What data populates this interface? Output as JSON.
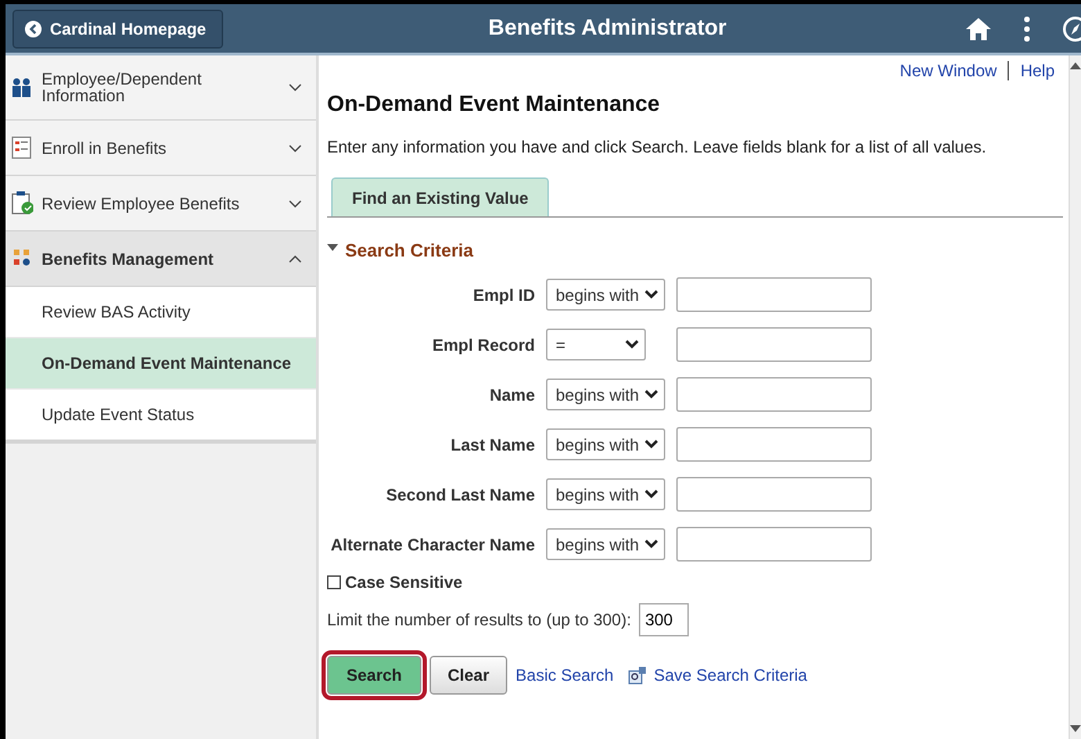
{
  "header": {
    "back_button": "Cardinal Homepage",
    "title": "Benefits Administrator"
  },
  "sidebar": {
    "items": [
      {
        "label": "Employee/Dependent Information",
        "expanded": false
      },
      {
        "label": "Enroll in Benefits",
        "expanded": false
      },
      {
        "label": "Review Employee Benefits",
        "expanded": false
      },
      {
        "label": "Benefits Management",
        "expanded": true,
        "children": [
          {
            "label": "Review BAS Activity",
            "selected": false
          },
          {
            "label": "On-Demand Event Maintenance",
            "selected": true
          },
          {
            "label": "Update Event Status",
            "selected": false
          }
        ]
      }
    ]
  },
  "top_links": [
    "New Window",
    "Help"
  ],
  "page_title": "On-Demand Event Maintenance",
  "instructions": "Enter any information you have and click Search. Leave fields blank for a list of all values.",
  "tabs": [
    {
      "label": "Find an Existing Value",
      "selected": true
    }
  ],
  "section": {
    "label": "Search Criteria",
    "expanded": true
  },
  "fields": [
    {
      "label": "Empl ID",
      "operator": "begins with"
    },
    {
      "label": "Empl Record",
      "operator": "="
    },
    {
      "label": "Name",
      "operator": "begins with"
    },
    {
      "label": "Last Name",
      "operator": "begins with"
    },
    {
      "label": "Second Last Name",
      "operator": "begins with"
    },
    {
      "label": "Alternate Character Name",
      "operator": "begins with"
    }
  ],
  "case_sensitive": {
    "label": "Case Sensitive",
    "checked": false
  },
  "limit": {
    "label": "Limit the number of results to (up to 300):",
    "value": "300"
  },
  "buttons": [
    {
      "label": "Search",
      "kind": "primary",
      "highlighted": true
    },
    {
      "label": "Clear",
      "kind": "secondary",
      "highlighted": false
    }
  ],
  "links": [
    {
      "label": "Basic Search",
      "kind": "plain"
    },
    {
      "label": "Save Search Criteria",
      "kind": "icon"
    }
  ]
}
